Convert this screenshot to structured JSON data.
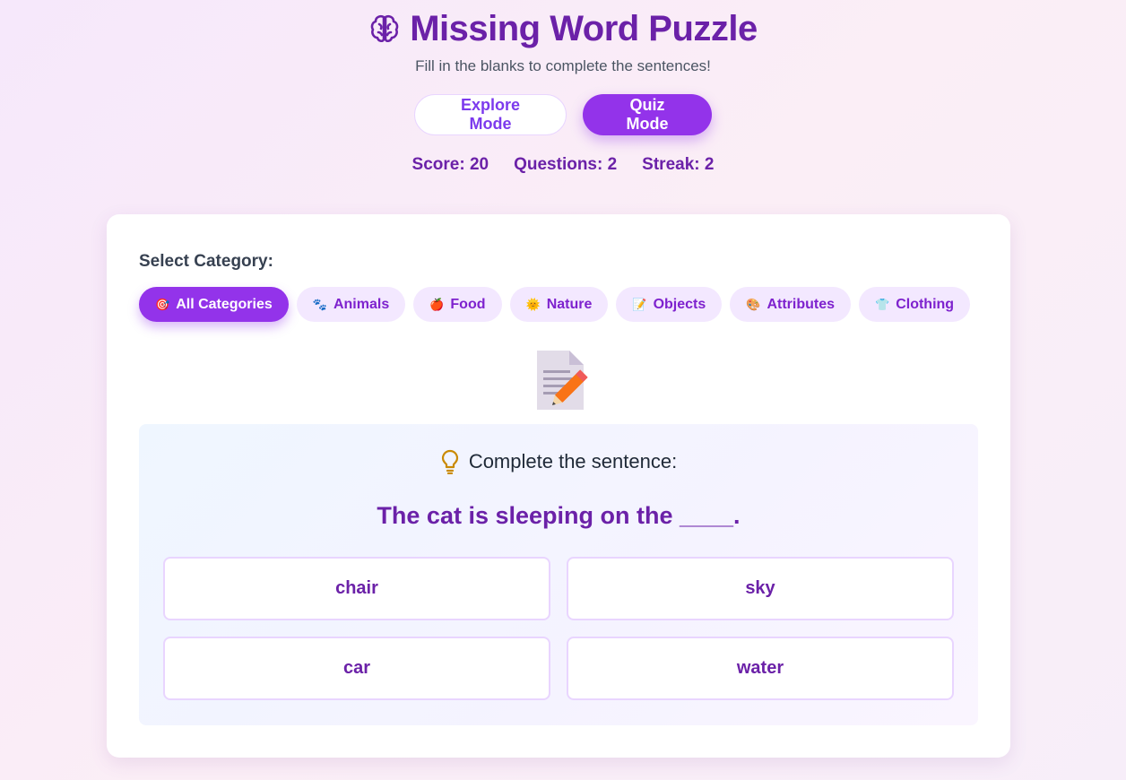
{
  "header": {
    "title": "Missing Word Puzzle",
    "subtitle": "Fill in the blanks to complete the sentences!",
    "icon": "brain-icon"
  },
  "modes": {
    "explore_label": "Explore Mode",
    "quiz_label": "Quiz Mode",
    "active": "quiz"
  },
  "stats": {
    "score": "Score: 20",
    "questions": "Questions: 2",
    "streak": "Streak: 2"
  },
  "categories": {
    "label": "Select Category:",
    "active": "All Categories",
    "items": [
      {
        "label": "All Categories",
        "icon": "🎯"
      },
      {
        "label": "Animals",
        "icon": "🐾"
      },
      {
        "label": "Food",
        "icon": "🍎"
      },
      {
        "label": "Nature",
        "icon": "🌞"
      },
      {
        "label": "Objects",
        "icon": "📝"
      },
      {
        "label": "Attributes",
        "icon": "🎨"
      },
      {
        "label": "Clothing",
        "icon": "👕"
      }
    ]
  },
  "question": {
    "illustration": "memo-icon",
    "prompt": "Complete the sentence:",
    "sentence": "The cat is sleeping on the ____.",
    "answers": [
      "chair",
      "sky",
      "car",
      "water"
    ]
  },
  "colors": {
    "accent": "#9333ea",
    "title": "#6b21a8",
    "chip_bg": "#f3e8ff"
  }
}
